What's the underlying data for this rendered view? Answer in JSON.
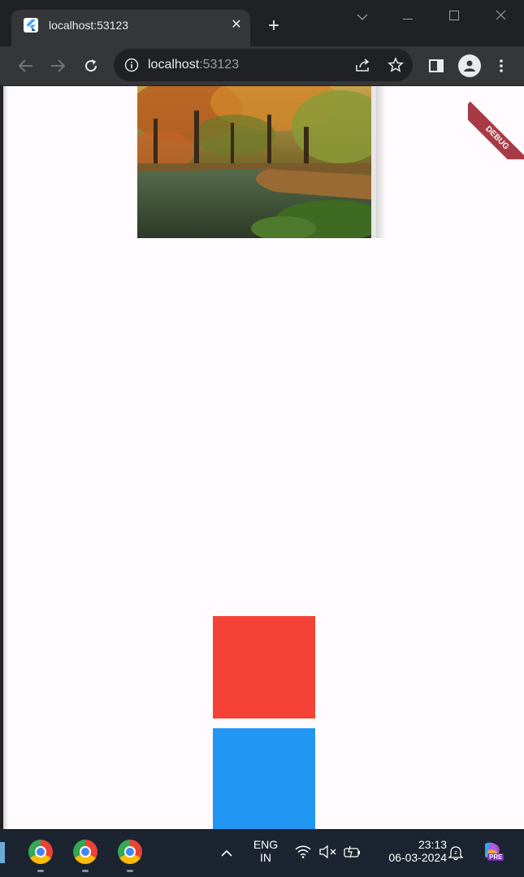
{
  "browser": {
    "tab_title": "localhost:53123",
    "url_host": "localhost",
    "url_port": ":53123"
  },
  "page": {
    "debug_banner": "DEBUG",
    "photo": "autumn-forest-pond-photo",
    "boxes": [
      {
        "name": "red-square",
        "color": "#f44336"
      },
      {
        "name": "blue-square",
        "color": "#2196f3"
      }
    ]
  },
  "taskbar": {
    "language_line1": "ENG",
    "language_line2": "IN",
    "time": "23:13",
    "date": "06-03-2024",
    "copilot_badge": "PRE"
  }
}
